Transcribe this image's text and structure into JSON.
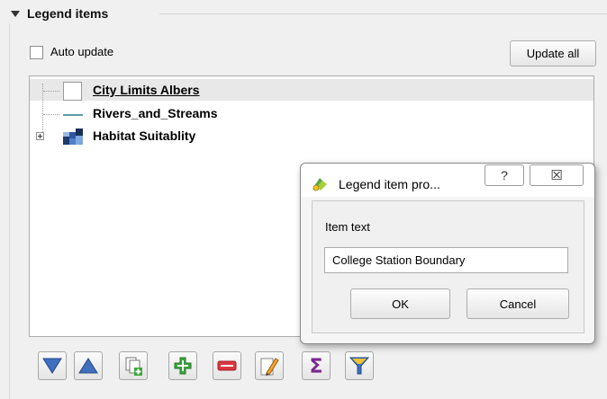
{
  "section": {
    "title": "Legend items"
  },
  "auto_update": {
    "label": "Auto update",
    "checked": false
  },
  "update_all_label": "Update all",
  "tree": {
    "items": [
      {
        "label": "City Limits Albers",
        "symbol": "polygon-symbol-icon"
      },
      {
        "label": "Rivers_and_Streams",
        "symbol": "line-symbol-icon",
        "color": "#5b9ea6"
      },
      {
        "label": "Habitat Suitablity",
        "symbol": "raster-symbol-icon"
      }
    ]
  },
  "toolbar": {
    "buttons": [
      {
        "name": "move-down-button",
        "icon": "triangle-down-icon"
      },
      {
        "name": "move-up-button",
        "icon": "triangle-up-icon"
      },
      {
        "name": "add-group-button",
        "icon": "add-group-icon"
      },
      {
        "name": "add-item-button",
        "icon": "plus-icon"
      },
      {
        "name": "remove-item-button",
        "icon": "minus-icon"
      },
      {
        "name": "edit-item-button",
        "icon": "pencil-icon"
      },
      {
        "name": "count-features-button",
        "icon": "sigma-icon"
      },
      {
        "name": "filter-legend-button",
        "icon": "filter-icon"
      }
    ]
  },
  "dialog": {
    "title": "Legend item pro...",
    "help_glyph": "?",
    "close_glyph": "☒",
    "item_text_label": "Item text",
    "item_text_value": "College Station Boundary",
    "ok_label": "OK",
    "cancel_label": "Cancel"
  },
  "colors": {
    "accent_blue": "#3f6fbd",
    "green": "#3ca63a",
    "red": "#d9363e",
    "purple": "#7a2a8e",
    "filter_yellow": "#f1c232"
  }
}
